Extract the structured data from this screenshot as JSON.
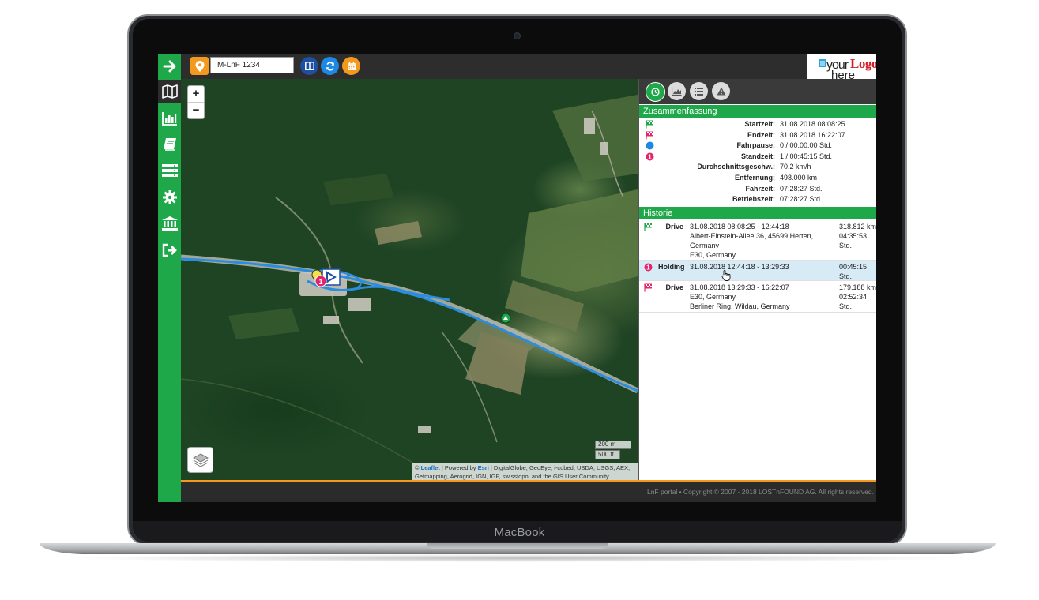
{
  "device": {
    "brand_label": "MacBook"
  },
  "topbar": {
    "vehicle_value": "M-LnF 1234",
    "logo_text_your": "your",
    "logo_text_logo": "Logo",
    "logo_text_here": "here",
    "logo_registered": "®"
  },
  "sidebar": {
    "items": [
      "toggle-arrow-icon",
      "map-icon",
      "chart-icon",
      "logbook-icon",
      "list-icon",
      "settings-icon",
      "bank-icon",
      "logout-icon"
    ]
  },
  "map": {
    "zoom_in": "+",
    "zoom_out": "−",
    "scale_metric": "200 m",
    "scale_imperial": "500 ft",
    "attribution_pre": "© ",
    "attribution_leaflet": "Leaflet",
    "attribution_mid": " | Powered by ",
    "attribution_esri": "Esri",
    "attribution_rest": " | DigitalGlobe, GeoEye, i-cubed, USDA, USGS, AEX, Getmapping, Aerogrid, IGN, IGP, swisstopo, and the GIS User Community",
    "route_color": "#2a8de0"
  },
  "summary": {
    "title": "Zusammenfassung",
    "rows": [
      {
        "icon": "start-flag-icon",
        "label": "Startzeit:",
        "value": "31.08.2018 08:08:25"
      },
      {
        "icon": "end-flag-icon",
        "label": "Endzeit:",
        "value": "31.08.2018 16:22:07"
      },
      {
        "icon": "pause-dot-icon",
        "label": "Fahrpause:",
        "value": "0 / 00:00:00 Std."
      },
      {
        "icon": "stop-number-icon",
        "label": "Standzeit:",
        "value": "1 / 00:45:15 Std."
      },
      {
        "icon": "",
        "label": "Durchschnittsgeschw.:",
        "value": "70.2 km/h"
      },
      {
        "icon": "",
        "label": "Entfernung:",
        "value": "498.000 km"
      },
      {
        "icon": "",
        "label": "Fahrzeit:",
        "value": "07:28:27 Std."
      },
      {
        "icon": "",
        "label": "Betriebszeit:",
        "value": "07:28:27 Std."
      }
    ]
  },
  "history": {
    "title": "Historie",
    "items": [
      {
        "icon": "start-flag-icon",
        "type": "Drive",
        "lines": [
          "31.08.2018 08:08:25 - 12:44:18",
          "Albert-Einstein-Allee 36, 45699 Herten,",
          "Germany",
          "E30, Germany"
        ],
        "dur": [
          "318.812 km",
          "04:35:53",
          "Std."
        ]
      },
      {
        "icon": "stop-number-icon",
        "type": "Holding",
        "lines": [
          "31.08.2018 12:44:18 - 13:29:33"
        ],
        "dur": [
          "00:45:15",
          "Std."
        ]
      },
      {
        "icon": "end-flag-icon",
        "type": "Drive",
        "lines": [
          "31.08.2018 13:29:33 - 16:22:07",
          "E30, Germany",
          "Berliner Ring, Wildau, Germany"
        ],
        "dur": [
          "179.188 km",
          "02:52:34",
          "Std."
        ]
      }
    ]
  },
  "footer": {
    "text": "LnF portal • Copyright © 2007 - 2018 LOSTnFOUND AG. All rights reserved."
  },
  "colors": {
    "green": "#1fa84a",
    "orange": "#f39a1e",
    "pink": "#e4236b",
    "blue": "#1e88e5",
    "navy": "#1d4fa3"
  }
}
